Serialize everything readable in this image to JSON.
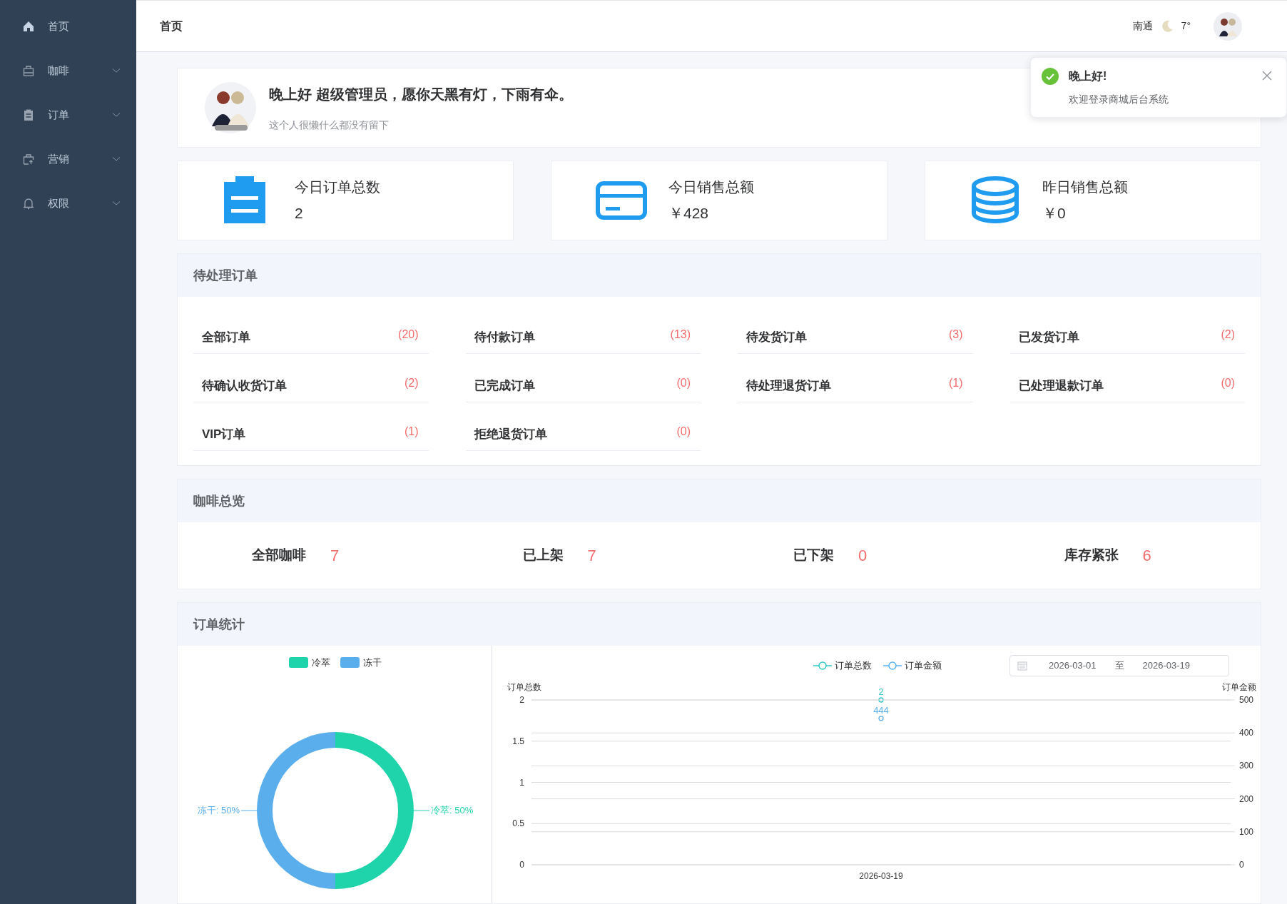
{
  "sidebar": {
    "items": [
      {
        "label": "首页",
        "kind": "link"
      },
      {
        "label": "咖啡",
        "kind": "submenu"
      },
      {
        "label": "订单",
        "kind": "submenu"
      },
      {
        "label": "营销",
        "kind": "submenu"
      },
      {
        "label": "权限",
        "kind": "submenu"
      }
    ]
  },
  "header": {
    "breadcrumb": "首页",
    "city": "南通",
    "temperature": "7°"
  },
  "notification": {
    "title": "晚上好!",
    "message": "欢迎登录商城后台系统"
  },
  "welcome": {
    "greeting": "晚上好 超级管理员，愿你天黑有灯，下雨有伞。",
    "signature": "这个人很懒什么都没有留下"
  },
  "stats": [
    {
      "label": "今日订单总数",
      "value": "2"
    },
    {
      "label": "今日销售总额",
      "value": "￥428"
    },
    {
      "label": "昨日销售总额",
      "value": "￥0"
    }
  ],
  "pending_orders": {
    "title": "待处理订单",
    "items": [
      {
        "label": "全部订单",
        "count": "(20)"
      },
      {
        "label": "待付款订单",
        "count": "(13)"
      },
      {
        "label": "待发货订单",
        "count": "(3)"
      },
      {
        "label": "已发货订单",
        "count": "(2)"
      },
      {
        "label": "待确认收货订单",
        "count": "(2)"
      },
      {
        "label": "已完成订单",
        "count": "(0)"
      },
      {
        "label": "待处理退货订单",
        "count": "(1)"
      },
      {
        "label": "已处理退款订单",
        "count": "(0)"
      },
      {
        "label": "VIP订单",
        "count": "(1)"
      },
      {
        "label": "拒绝退货订单",
        "count": "(0)"
      }
    ]
  },
  "coffee_overview": {
    "title": "咖啡总览",
    "items": [
      {
        "label": "全部咖啡",
        "count": "7"
      },
      {
        "label": "已上架",
        "count": "7"
      },
      {
        "label": "已下架",
        "count": "0"
      },
      {
        "label": "库存紧张",
        "count": "6"
      }
    ]
  },
  "order_statistics": {
    "title": "订单统计",
    "type_chart": {
      "chart_data": {
        "type": "donut",
        "legend": "top",
        "categories": [
          "冷萃",
          "冻干"
        ],
        "values": [
          50,
          50
        ],
        "value_labels": [
          "冷萃: 50%",
          "冻干: 50%"
        ]
      }
    },
    "date_range": {
      "start": "2026-03-01",
      "separator": "至",
      "end": "2026-03-19"
    },
    "count_chart": {
      "chart_data": {
        "type": "line",
        "ylabel": "订单总数",
        "categories": [
          "2026-03-19"
        ],
        "series": [
          {
            "name": "订单总数",
            "color": "#2ec7c9",
            "marker": "circle",
            "values": [
              2
            ]
          }
        ],
        "ylim": [
          0,
          2
        ],
        "yticks": [
          0,
          0.5,
          1,
          1.5,
          2
        ],
        "grid": true,
        "legend": "top",
        "data_labels": true
      }
    },
    "amount_chart": {
      "chart_data": {
        "type": "line",
        "ylabel": "订单金额",
        "series": [
          {
            "name": "订单金额",
            "color": "#5ab1ef",
            "marker": "circle",
            "values": [
              444
            ]
          }
        ],
        "ylim": [
          0,
          500
        ],
        "yticks": [
          0,
          100,
          200,
          300,
          400,
          500
        ],
        "grid": true,
        "legend": "top",
        "data_labels": true
      }
    }
  }
}
